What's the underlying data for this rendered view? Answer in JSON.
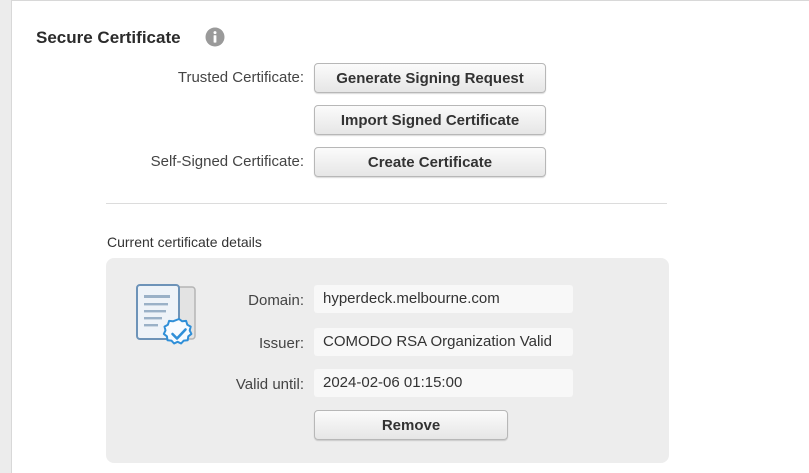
{
  "section": {
    "title": "Secure Certificate",
    "info_icon": "info-icon"
  },
  "trusted": {
    "label": "Trusted Certificate:",
    "generate_label": "Generate Signing Request",
    "import_label": "Import Signed Certificate"
  },
  "self_signed": {
    "label": "Self-Signed Certificate:",
    "create_label": "Create Certificate"
  },
  "details": {
    "title": "Current certificate details",
    "icon": "certificate-icon",
    "domain_label": "Domain:",
    "domain_value": "hyperdeck.melbourne.com",
    "issuer_label": "Issuer:",
    "issuer_value": "COMODO RSA Organization Valid",
    "valid_label": "Valid until:",
    "valid_value": "2024-02-06 01:15:00",
    "remove_label": "Remove"
  },
  "colors": {
    "panel_bg": "#ffffff",
    "details_bg": "#ededed",
    "accent_blue": "#2f8fd8"
  }
}
